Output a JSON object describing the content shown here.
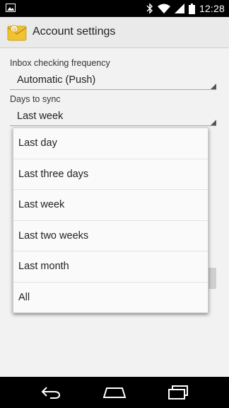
{
  "status_bar": {
    "time": "12:28",
    "icons": [
      "image-notification-icon",
      "bluetooth-icon",
      "wifi-icon",
      "cell-signal-icon",
      "battery-icon"
    ]
  },
  "action_bar": {
    "title": "Account settings",
    "app_icon": "email-app-icon"
  },
  "settings": {
    "inbox_checking_frequency": {
      "label": "Inbox checking frequency",
      "value": "Automatic (Push)"
    },
    "days_to_sync": {
      "label": "Days to sync",
      "value": "Last week"
    }
  },
  "dropdown": {
    "options": [
      {
        "label": "Last day"
      },
      {
        "label": "Last three days"
      },
      {
        "label": "Last week"
      },
      {
        "label": "Last two weeks"
      },
      {
        "label": "Last month"
      },
      {
        "label": "All"
      }
    ]
  },
  "nav_bar": {
    "buttons": [
      "back-icon",
      "home-icon",
      "recents-icon"
    ]
  },
  "colors": {
    "status_bar": "#000000",
    "action_bar": "#eaeaea",
    "background": "#f2f2f2",
    "dropdown": "#fafafa"
  }
}
